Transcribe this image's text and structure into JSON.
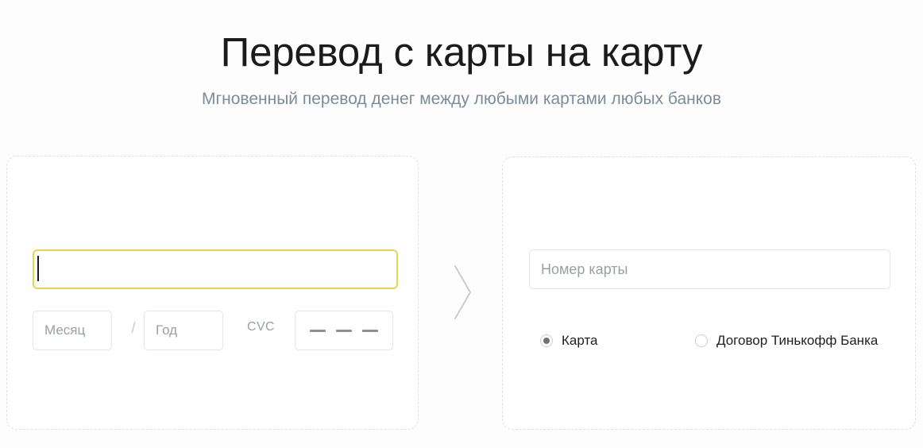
{
  "header": {
    "title": "Перевод с карты на карту",
    "subtitle": "Мгновенный перевод денег между любыми картами любых банков"
  },
  "colors": {
    "page_background": "#fdfdfd",
    "title": "#1b1b1b",
    "subtitle": "#7f8b99",
    "card_border": "#dcdfe3",
    "field_border": "#e3e5e8",
    "focus_border": "#e8d44d",
    "placeholder": "#9a9fa6",
    "radio_dot": "#6d7279",
    "arrow": "#c8cbcf"
  },
  "source_card": {
    "card_number": {
      "value": "",
      "placeholder": "",
      "focused": true
    },
    "expiry": {
      "month_placeholder": "Месяц",
      "month_value": "",
      "separator": "/",
      "year_placeholder": "Год",
      "year_value": ""
    },
    "cvc": {
      "label": "CVC",
      "masked_digits": [
        "—",
        "—",
        "—"
      ]
    }
  },
  "arrow": {
    "icon": "chevron-right-icon"
  },
  "target_card": {
    "card_number": {
      "value": "",
      "placeholder": "Номер карты"
    },
    "recipient_type": {
      "selected": "card",
      "options": [
        {
          "id": "card",
          "label": "Карта",
          "checked": true
        },
        {
          "id": "contract",
          "label": "Договор Тинькофф Банка",
          "checked": false
        }
      ]
    }
  }
}
